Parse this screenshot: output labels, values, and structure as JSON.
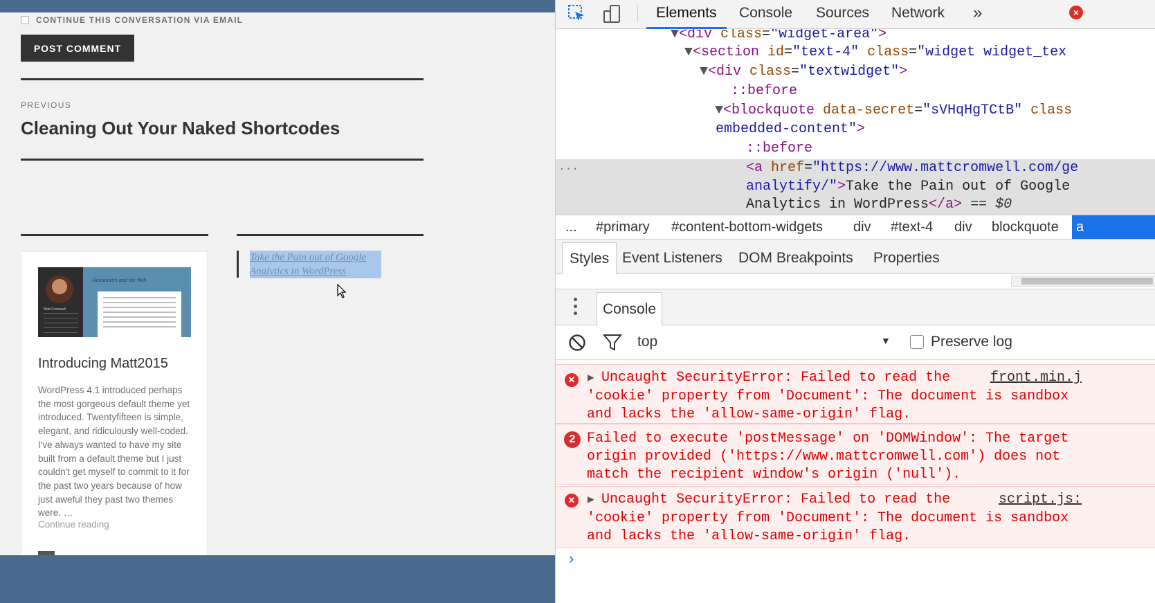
{
  "page": {
    "email_option_label": "CONTINUE THIS CONVERSATION VIA EMAIL",
    "post_button_label": "POST COMMENT",
    "previous_label": "PREVIOUS",
    "previous_title": "Cleaning Out Your Naked Shortcodes",
    "card": {
      "title": "Introducing Matt2015",
      "excerpt": "WordPress 4.1 introduced perhaps the most gorgeous default theme yet introduced. Twentyfifteen is simple, elegant, and ridiculously well-coded. I've always wanted to have my site built from a default theme but I just couldn't get myself to commit to it for the past two years because of how just aweful they past two themes were. …",
      "more_link": "Continue reading",
      "thumb_title": "Humanities and the Web",
      "thumb_name": "Matt Cromwell"
    },
    "embed_link_line1": "Take the Pain out of Google",
    "embed_link_line2": "Analytics in WordPress"
  },
  "devtools": {
    "tabs": [
      "Elements",
      "Console",
      "Sources",
      "Network"
    ],
    "more_tabs": "»",
    "close": "×",
    "tree": {
      "l0": {
        "tag_open": "<div ",
        "attr": "class",
        "eq": "=",
        "val": "\"widget-area\"",
        "tag_close": ">"
      },
      "l1": {
        "tag_open": "<section ",
        "a1": "id",
        "v1": "\"text-4\"",
        "a2": "class",
        "v2": "\"widget widget_tex"
      },
      "l2": {
        "tag_open": "<div ",
        "attr": "class",
        "val": "\"textwidget\"",
        "tag_close": ">"
      },
      "l3": "::before",
      "l4": {
        "tag_open": "<blockquote ",
        "a1": "data-secret",
        "v1": "\"sVHqHgTCtB\"",
        "a2": "class"
      },
      "l5": {
        "val": "embedded-content\"",
        "tag_close": ">"
      },
      "l6": "::before",
      "l7": {
        "tag_open": "<a ",
        "attr": "href",
        "val": "\"https://www.mattcromwell.com/ge"
      },
      "l8": {
        "val": "analytify/\"",
        "tag_close": ">",
        "text": "Take the Pain out of Google"
      },
      "l9": {
        "text": "Analytics in WordPress",
        "tag_end": "</a>",
        "ref": " == $0"
      },
      "dots": "..."
    },
    "breadcrumbs": [
      "...",
      "#primary",
      "#content-bottom-widgets",
      "div",
      "#text-4",
      "div",
      "blockquote"
    ],
    "breadcrumb_selected": "a",
    "subtabs": [
      "Styles",
      "Event Listeners",
      "DOM Breakpoints",
      "Properties"
    ],
    "drawer_tab": "Console",
    "context": "top",
    "preserve_log": "Preserve log",
    "messages": [
      {
        "lines": [
          "Uncaught SecurityError: Failed to read the",
          "'cookie' property from 'Document': The document is sandbox",
          "and lacks the 'allow-same-origin' flag."
        ],
        "source": "front.min.j"
      },
      {
        "count": "2",
        "lines": [
          "Failed to execute 'postMessage' on 'DOMWindow': The target",
          "origin provided ('https://www.mattcromwell.com') does not",
          "match the recipient window's origin ('null')."
        ]
      },
      {
        "lines": [
          "Uncaught SecurityError: Failed to read the",
          "'cookie' property from 'Document': The document is sandbox",
          "and lacks the 'allow-same-origin' flag."
        ],
        "source": "script.js:"
      }
    ],
    "prompt": "›"
  },
  "colors": {
    "accent": "#1a73e8",
    "error": "#e00000",
    "frame": "#4a6a8f"
  }
}
